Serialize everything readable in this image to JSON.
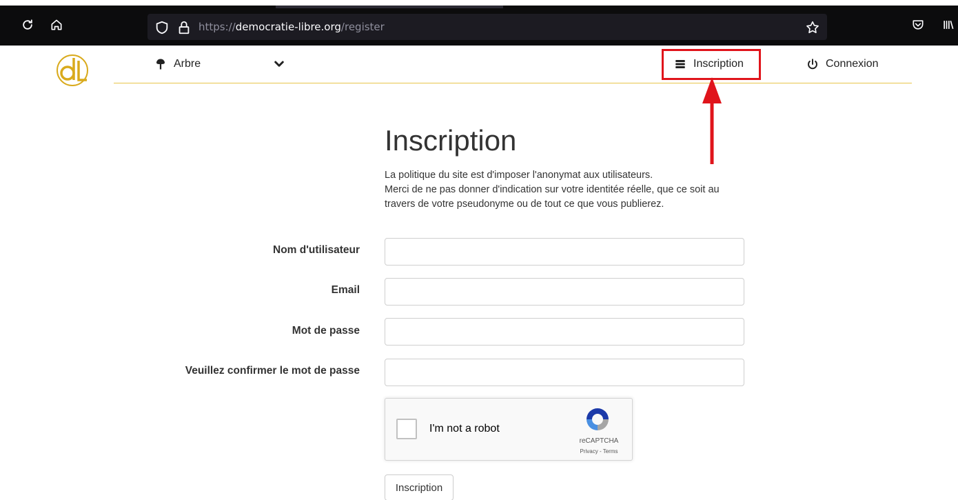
{
  "browser": {
    "url_scheme": "https://",
    "url_host": "democratie-libre.org",
    "url_path": "/register"
  },
  "nav": {
    "tree_label": "Arbre",
    "register_label": "Inscription",
    "login_label": "Connexion"
  },
  "page": {
    "title": "Inscription",
    "intro_lines": [
      "La politique du site est d'imposer l'anonymat aux utilisateurs.",
      "Merci de ne pas donner d'indication sur votre identitée réelle, que ce soit au",
      "travers de votre pseudonyme ou de tout ce que vous publierez."
    ]
  },
  "form": {
    "fields": [
      {
        "label": "Nom d'utilisateur",
        "value": ""
      },
      {
        "label": "Email",
        "value": ""
      },
      {
        "label": "Mot de passe",
        "value": ""
      },
      {
        "label": "Veuillez confirmer le mot de passe",
        "value": ""
      }
    ],
    "submit_label": "Inscription"
  },
  "recaptcha": {
    "label": "I'm not a robot",
    "brand": "reCAPTCHA",
    "links": "Privacy - Terms"
  },
  "colors": {
    "accent_gold": "#e8c54a",
    "annotation_red": "#e0141b"
  }
}
